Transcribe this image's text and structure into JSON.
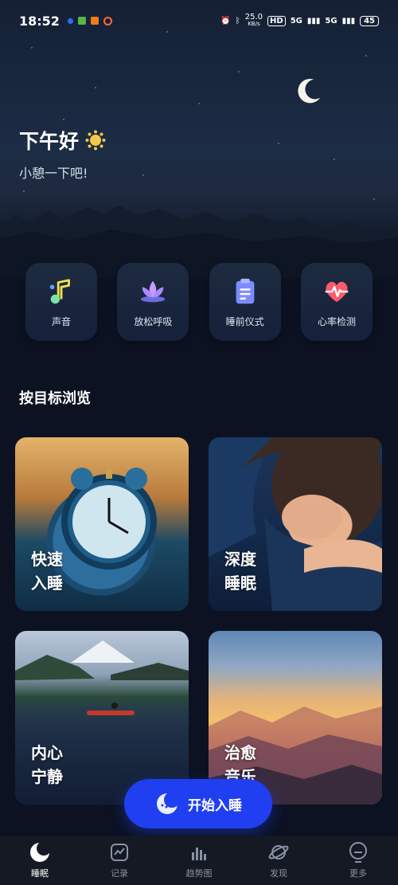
{
  "status": {
    "time": "18:52",
    "net_speed": "25.0",
    "net_unit": "KB/s",
    "hd": "HD",
    "sig1": "5G",
    "sig2": "5G",
    "battery": "45"
  },
  "greeting": {
    "title": "下午好",
    "subtitle": "小憩一下吧!"
  },
  "actions": [
    {
      "label": "声音",
      "icon": "music-note-icon"
    },
    {
      "label": "放松呼吸",
      "icon": "lotus-icon"
    },
    {
      "label": "睡前仪式",
      "icon": "clipboard-icon"
    },
    {
      "label": "心率检测",
      "icon": "heart-rate-icon"
    }
  ],
  "section": {
    "title": "按目标浏览"
  },
  "cards": [
    {
      "line1": "快速",
      "line2": "入睡"
    },
    {
      "line1": "深度",
      "line2": "睡眠"
    },
    {
      "line1": "内心",
      "line2": "宁静"
    },
    {
      "line1": "治愈",
      "line2": "音乐"
    }
  ],
  "start_button": {
    "label": "开始入睡"
  },
  "nav": [
    {
      "label": "睡眠",
      "icon": "moon-icon"
    },
    {
      "label": "记录",
      "icon": "chart-box-icon"
    },
    {
      "label": "趋势图",
      "icon": "bar-chart-icon"
    },
    {
      "label": "发现",
      "icon": "planet-icon"
    },
    {
      "label": "更多",
      "icon": "smile-icon"
    }
  ],
  "colors": {
    "background": "#0c1222",
    "accent_blue": "#1f3ff0",
    "nav_bg": "#141923"
  }
}
